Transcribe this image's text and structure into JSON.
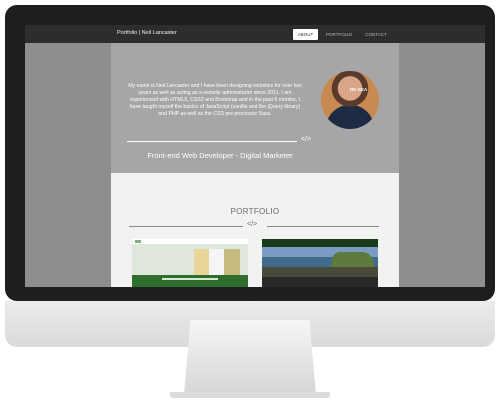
{
  "nav": {
    "brand": "Portfolio | Neil Lancaster",
    "items": [
      {
        "label": "ABOUT",
        "active": true
      },
      {
        "label": "PORTFOLIO",
        "active": false
      },
      {
        "label": "CONTACT",
        "active": false
      }
    ]
  },
  "hero": {
    "intro": "My name is Neil Lancaster and I have been designing websites for over two years as well as acting as a website administrator since 2011. I am experienced with HTML5, CSS3 and Bootstrap and in the past 6 months, I have taught myself the basics of JavaScript (vanilla and the jQuery library) and PHP as well as the CSS pre processor Sass.",
    "code_symbol": "</>",
    "tagline": "Front-end Web Developer - Digital Marketer",
    "avatar_shirt_text": "DE GEA"
  },
  "portfolio": {
    "title": "PORTFOLIO",
    "code_symbol": "</>"
  },
  "colors": {
    "navbar": "#2d2d2d",
    "hero_bg": "#a6a6a6",
    "side_bg": "#8e8e8e",
    "section_bg": "#f2f2f2"
  }
}
